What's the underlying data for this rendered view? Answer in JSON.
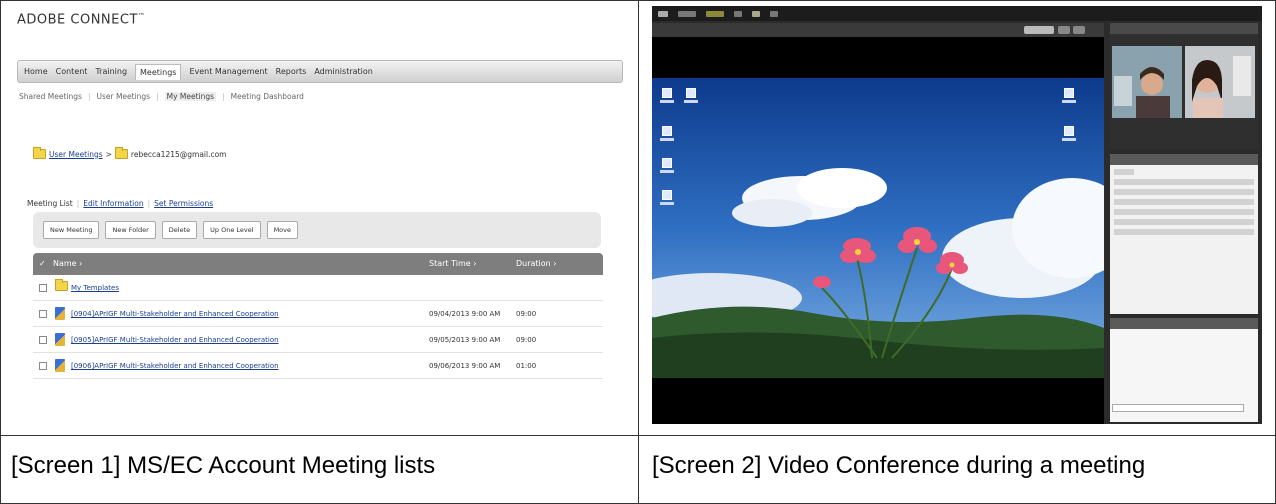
{
  "screen1": {
    "logo": "ADOBE CONNECT",
    "logo_mark": "™",
    "topnav": [
      "Home",
      "Content",
      "Training",
      "Meetings",
      "Event Management",
      "Reports",
      "Administration"
    ],
    "topnav_active": "Meetings",
    "subnav": [
      "Shared Meetings",
      "User Meetings",
      "My Meetings",
      "Meeting Dashboard"
    ],
    "breadcrumb": {
      "root": "User Meetings",
      "separator": ">",
      "current": "rebecca1215@gmail.com"
    },
    "tabs": [
      "Meeting List",
      "Edit Information",
      "Set Permissions"
    ],
    "toolbar": [
      "New Meeting",
      "New Folder",
      "Delete",
      "Up One Level",
      "Move"
    ],
    "table": {
      "headers": {
        "name": "Name ›",
        "start": "Start Time ›",
        "duration": "Duration ›"
      },
      "rows": [
        {
          "type": "folder",
          "name": "My Templates",
          "start": "",
          "duration": ""
        },
        {
          "type": "meeting",
          "name": "[0904]APrIGF Multi-Stakeholder and Enhanced Cooperation",
          "start": "09/04/2013 9:00 AM",
          "duration": "09:00"
        },
        {
          "type": "meeting",
          "name": "[0905]APrIGF Multi-Stakeholder and Enhanced Cooperation",
          "start": "09/05/2013 9:00 AM",
          "duration": "09:00"
        },
        {
          "type": "meeting",
          "name": "[0906]APrIGF Multi-Stakeholder and Enhanced Cooperation",
          "start": "09/06/2013 9:00 AM",
          "duration": "01:00"
        }
      ]
    }
  },
  "captions": {
    "left": "[Screen 1] MS/EC Account Meeting lists",
    "right": "[Screen 2] Video Conference during a meeting"
  },
  "colors": {
    "sky_top": "#123d8c",
    "sky_mid": "#2f6fc2",
    "flower_pink": "#e8577b",
    "hill_green": "#2e5a2e",
    "table_header": "#7e7e7e",
    "folder_yellow": "#f2d54b"
  }
}
